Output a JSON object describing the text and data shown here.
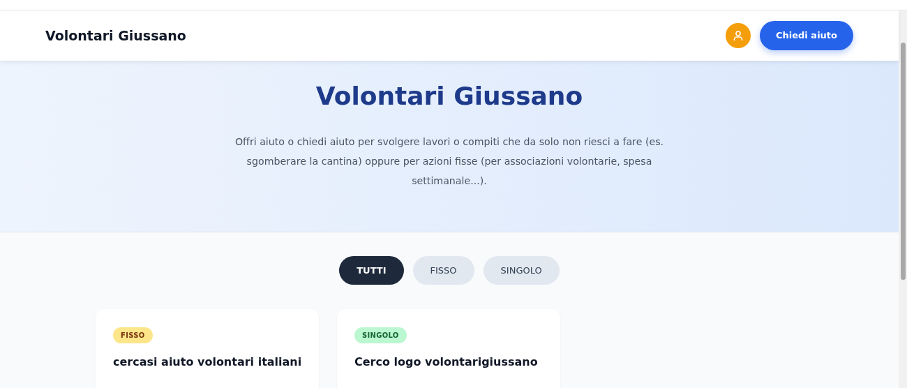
{
  "header": {
    "brand": "Volontari Giussano",
    "cta": "Chiedi aiuto"
  },
  "hero": {
    "title": "Volontari Giussano",
    "description": "Offri aiuto o chiedi aiuto per svolgere lavori o compiti che da solo non riesci a fare (es. sgomberare la cantina) oppure per azioni fisse (per associazioni volontarie, spesa settimanale...)."
  },
  "filters": [
    {
      "label": "TUTTI",
      "selected": true
    },
    {
      "label": "FISSO",
      "selected": false
    },
    {
      "label": "SINGOLO",
      "selected": false
    }
  ],
  "cards": [
    {
      "kind": "fisso",
      "tag": "FISSO",
      "title": "cercasi aiuto volontari italiani"
    },
    {
      "kind": "singolo",
      "tag": "SINGOLO",
      "title": "Cerco logo volontarigiussano"
    }
  ]
}
